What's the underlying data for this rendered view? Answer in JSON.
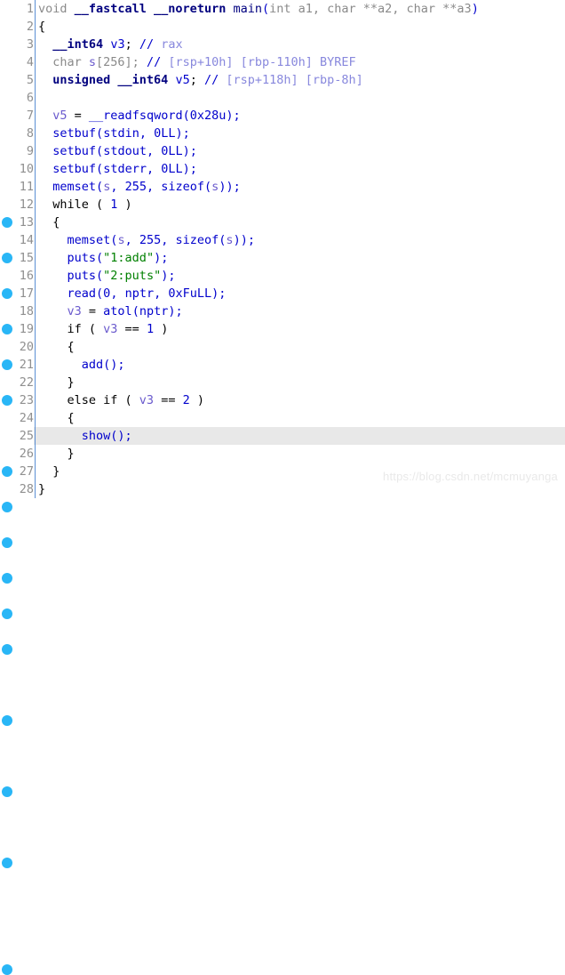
{
  "view": {
    "title": "Decompiler pseudocode view",
    "current_line": 25,
    "total_lines": 28,
    "colors": {
      "background": "#ffffff",
      "breakpoint_dot": "#29b6f6",
      "gutter_divider": "#5b8fd4",
      "line_number": "#8f8f8f",
      "current_line_highlight": "#e8e8e8",
      "string": "#008000",
      "comment": "#8888dd",
      "keyword": "#00007f",
      "function": "#0000cc",
      "variable": "#6a5acd",
      "type": "#8a8a8a",
      "watermark": "#e9e9e9"
    }
  },
  "watermark": {
    "text": "https://blog.csdn.net/mcmuyanga"
  },
  "lines": [
    {
      "num": "1",
      "dot": false,
      "tokens": [
        {
          "text": "void ",
          "cls": "t-type"
        },
        {
          "text": "__fastcall ",
          "cls": "t-keyword"
        },
        {
          "text": "__noreturn ",
          "cls": "t-keyword"
        },
        {
          "text": "main",
          "cls": "t-main"
        },
        {
          "text": "(",
          "cls": "t-paren"
        },
        {
          "text": "int a1, char **a2, char **a3",
          "cls": "t-arg"
        },
        {
          "text": ")",
          "cls": "t-paren"
        }
      ]
    },
    {
      "num": "2",
      "dot": false,
      "tokens": [
        {
          "text": "{",
          "cls": "t-punct"
        }
      ]
    },
    {
      "num": "3",
      "dot": false,
      "tokens": [
        {
          "text": "  ",
          "cls": "t-punct"
        },
        {
          "text": "__int64",
          "cls": "t-keyword"
        },
        {
          "text": " ",
          "cls": "t-punct"
        },
        {
          "text": "v3",
          "cls": "t-func"
        },
        {
          "text": "; ",
          "cls": "t-punct"
        },
        {
          "text": "//",
          "cls": "t-cmtmark"
        },
        {
          "text": " rax",
          "cls": "t-cmt"
        }
      ]
    },
    {
      "num": "4",
      "dot": false,
      "tokens": [
        {
          "text": "  char ",
          "cls": "t-type"
        },
        {
          "text": "s",
          "cls": "t-var"
        },
        {
          "text": "[256]; ",
          "cls": "t-type"
        },
        {
          "text": "//",
          "cls": "t-cmtmark"
        },
        {
          "text": " [rsp+10h] [rbp-110h] BYREF",
          "cls": "t-cmt"
        }
      ]
    },
    {
      "num": "5",
      "dot": false,
      "tokens": [
        {
          "text": "  unsigned __int64",
          "cls": "t-keyword"
        },
        {
          "text": " ",
          "cls": "t-punct"
        },
        {
          "text": "v5",
          "cls": "t-func"
        },
        {
          "text": "; ",
          "cls": "t-punct"
        },
        {
          "text": "//",
          "cls": "t-cmtmark"
        },
        {
          "text": " [rsp+118h] [rbp-8h]",
          "cls": "t-cmt"
        }
      ]
    },
    {
      "num": "6",
      "dot": false,
      "tokens": []
    },
    {
      "num": "7",
      "dot": true,
      "tokens": [
        {
          "text": "  ",
          "cls": "t-punct"
        },
        {
          "text": "v5",
          "cls": "t-var"
        },
        {
          "text": " = ",
          "cls": "t-punct"
        },
        {
          "text": "__readfsqword",
          "cls": "t-func"
        },
        {
          "text": "(",
          "cls": "t-paren"
        },
        {
          "text": "0x28u",
          "cls": "t-num"
        },
        {
          "text": ");",
          "cls": "t-paren"
        }
      ]
    },
    {
      "num": "8",
      "dot": true,
      "tokens": [
        {
          "text": "  ",
          "cls": "t-punct"
        },
        {
          "text": "setbuf",
          "cls": "t-func"
        },
        {
          "text": "(",
          "cls": "t-paren"
        },
        {
          "text": "stdin",
          "cls": "t-func"
        },
        {
          "text": ", ",
          "cls": "t-paren"
        },
        {
          "text": "0LL",
          "cls": "t-num"
        },
        {
          "text": ");",
          "cls": "t-paren"
        }
      ]
    },
    {
      "num": "9",
      "dot": true,
      "tokens": [
        {
          "text": "  ",
          "cls": "t-punct"
        },
        {
          "text": "setbuf",
          "cls": "t-func"
        },
        {
          "text": "(",
          "cls": "t-paren"
        },
        {
          "text": "stdout",
          "cls": "t-func"
        },
        {
          "text": ", ",
          "cls": "t-paren"
        },
        {
          "text": "0LL",
          "cls": "t-num"
        },
        {
          "text": ");",
          "cls": "t-paren"
        }
      ]
    },
    {
      "num": "10",
      "dot": true,
      "tokens": [
        {
          "text": "  ",
          "cls": "t-punct"
        },
        {
          "text": "setbuf",
          "cls": "t-func"
        },
        {
          "text": "(",
          "cls": "t-paren"
        },
        {
          "text": "stderr",
          "cls": "t-func"
        },
        {
          "text": ", ",
          "cls": "t-paren"
        },
        {
          "text": "0LL",
          "cls": "t-num"
        },
        {
          "text": ");",
          "cls": "t-paren"
        }
      ]
    },
    {
      "num": "11",
      "dot": true,
      "tokens": [
        {
          "text": "  ",
          "cls": "t-punct"
        },
        {
          "text": "memset",
          "cls": "t-func"
        },
        {
          "text": "(",
          "cls": "t-paren"
        },
        {
          "text": "s",
          "cls": "t-var"
        },
        {
          "text": ", ",
          "cls": "t-paren"
        },
        {
          "text": "255",
          "cls": "t-num"
        },
        {
          "text": ", ",
          "cls": "t-paren"
        },
        {
          "text": "sizeof",
          "cls": "t-func"
        },
        {
          "text": "(",
          "cls": "t-paren"
        },
        {
          "text": "s",
          "cls": "t-var"
        },
        {
          "text": "));",
          "cls": "t-paren"
        }
      ]
    },
    {
      "num": "12",
      "dot": true,
      "tokens": [
        {
          "text": "  while ( ",
          "cls": "t-ctrl"
        },
        {
          "text": "1",
          "cls": "t-num"
        },
        {
          "text": " )",
          "cls": "t-ctrl"
        }
      ]
    },
    {
      "num": "13",
      "dot": false,
      "tokens": [
        {
          "text": "  {",
          "cls": "t-punct"
        }
      ]
    },
    {
      "num": "14",
      "dot": true,
      "tokens": [
        {
          "text": "    ",
          "cls": "t-punct"
        },
        {
          "text": "memset",
          "cls": "t-func"
        },
        {
          "text": "(",
          "cls": "t-paren"
        },
        {
          "text": "s",
          "cls": "t-var"
        },
        {
          "text": ", ",
          "cls": "t-paren"
        },
        {
          "text": "255",
          "cls": "t-num"
        },
        {
          "text": ", ",
          "cls": "t-paren"
        },
        {
          "text": "sizeof",
          "cls": "t-func"
        },
        {
          "text": "(",
          "cls": "t-paren"
        },
        {
          "text": "s",
          "cls": "t-var"
        },
        {
          "text": "));",
          "cls": "t-paren"
        }
      ]
    },
    {
      "num": "15",
      "dot": true,
      "tokens": [
        {
          "text": "    ",
          "cls": "t-punct"
        },
        {
          "text": "puts",
          "cls": "t-func"
        },
        {
          "text": "(",
          "cls": "t-paren"
        },
        {
          "text": "\"1:add\"",
          "cls": "t-str"
        },
        {
          "text": ");",
          "cls": "t-paren"
        }
      ]
    },
    {
      "num": "16",
      "dot": true,
      "tokens": [
        {
          "text": "    ",
          "cls": "t-punct"
        },
        {
          "text": "puts",
          "cls": "t-func"
        },
        {
          "text": "(",
          "cls": "t-paren"
        },
        {
          "text": "\"2:puts\"",
          "cls": "t-str"
        },
        {
          "text": ");",
          "cls": "t-paren"
        }
      ]
    },
    {
      "num": "17",
      "dot": true,
      "tokens": [
        {
          "text": "    ",
          "cls": "t-punct"
        },
        {
          "text": "read",
          "cls": "t-func"
        },
        {
          "text": "(",
          "cls": "t-paren"
        },
        {
          "text": "0",
          "cls": "t-num"
        },
        {
          "text": ", ",
          "cls": "t-paren"
        },
        {
          "text": "nptr",
          "cls": "t-func"
        },
        {
          "text": ", ",
          "cls": "t-paren"
        },
        {
          "text": "0xFuLL",
          "cls": "t-num"
        },
        {
          "text": ");",
          "cls": "t-paren"
        }
      ]
    },
    {
      "num": "18",
      "dot": true,
      "tokens": [
        {
          "text": "    ",
          "cls": "t-punct"
        },
        {
          "text": "v3",
          "cls": "t-var"
        },
        {
          "text": " = ",
          "cls": "t-punct"
        },
        {
          "text": "atol",
          "cls": "t-func"
        },
        {
          "text": "(",
          "cls": "t-paren"
        },
        {
          "text": "nptr",
          "cls": "t-func"
        },
        {
          "text": ");",
          "cls": "t-paren"
        }
      ]
    },
    {
      "num": "19",
      "dot": true,
      "tokens": [
        {
          "text": "    if ( ",
          "cls": "t-ctrl"
        },
        {
          "text": "v3",
          "cls": "t-var"
        },
        {
          "text": " == ",
          "cls": "t-ctrl"
        },
        {
          "text": "1",
          "cls": "t-num"
        },
        {
          "text": " )",
          "cls": "t-ctrl"
        }
      ]
    },
    {
      "num": "20",
      "dot": false,
      "tokens": [
        {
          "text": "    {",
          "cls": "t-punct"
        }
      ]
    },
    {
      "num": "21",
      "dot": true,
      "tokens": [
        {
          "text": "      ",
          "cls": "t-punct"
        },
        {
          "text": "add",
          "cls": "t-func"
        },
        {
          "text": "();",
          "cls": "t-paren"
        }
      ]
    },
    {
      "num": "22",
      "dot": false,
      "tokens": [
        {
          "text": "    }",
          "cls": "t-punct"
        }
      ]
    },
    {
      "num": "23",
      "dot": true,
      "tokens": [
        {
          "text": "    else if ( ",
          "cls": "t-ctrl"
        },
        {
          "text": "v3",
          "cls": "t-var"
        },
        {
          "text": " == ",
          "cls": "t-ctrl"
        },
        {
          "text": "2",
          "cls": "t-num"
        },
        {
          "text": " )",
          "cls": "t-ctrl"
        }
      ]
    },
    {
      "num": "24",
      "dot": false,
      "tokens": [
        {
          "text": "    {",
          "cls": "t-punct"
        }
      ]
    },
    {
      "num": "25",
      "dot": true,
      "current": true,
      "tokens": [
        {
          "text": "      ",
          "cls": "t-punct"
        },
        {
          "text": "show",
          "cls": "t-func"
        },
        {
          "text": "();",
          "cls": "t-paren"
        }
      ]
    },
    {
      "num": "26",
      "dot": false,
      "tokens": [
        {
          "text": "    }",
          "cls": "t-punct"
        }
      ]
    },
    {
      "num": "27",
      "dot": false,
      "tokens": [
        {
          "text": "  }",
          "cls": "t-punct"
        }
      ]
    },
    {
      "num": "28",
      "dot": true,
      "tokens": [
        {
          "text": "}",
          "cls": "t-punct"
        }
      ]
    }
  ]
}
